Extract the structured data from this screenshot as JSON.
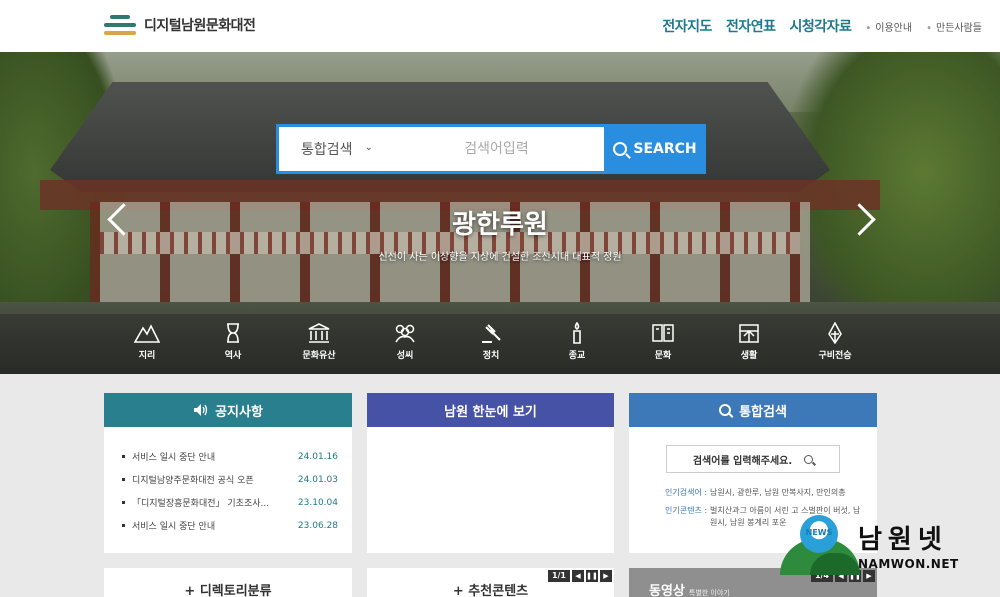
{
  "header": {
    "logo_text": "디지털남원문화대전",
    "main_links": [
      "전자지도",
      "전자연표",
      "시청각자료"
    ],
    "sub_links": [
      "이용안내",
      "만든사람들"
    ]
  },
  "search": {
    "category": "통합검색",
    "placeholder": "검색어입력",
    "button": "SEARCH"
  },
  "slide": {
    "title": "광한루원",
    "subtitle": "신선이 사는 이상향을 지상에 건설한 조선시대 대표적 정원"
  },
  "categories": [
    {
      "label": "지리",
      "icon": "mountain-icon"
    },
    {
      "label": "역사",
      "icon": "hourglass-icon"
    },
    {
      "label": "문화유산",
      "icon": "temple-icon"
    },
    {
      "label": "성씨",
      "icon": "people-icon"
    },
    {
      "label": "정치",
      "icon": "gavel-icon"
    },
    {
      "label": "종교",
      "icon": "candle-icon"
    },
    {
      "label": "문화",
      "icon": "book-icon"
    },
    {
      "label": "생활",
      "icon": "house-icon"
    },
    {
      "label": "구비전승",
      "icon": "pen-icon"
    }
  ],
  "notice": {
    "title": "공지사항",
    "items": [
      {
        "title": "서비스 일시 중단 안내",
        "date": "24.01.16"
      },
      {
        "title": "디지털남양주문화대전 공식 오픈",
        "date": "24.01.03"
      },
      {
        "title": "「디지털장흥문화대전」 기초조사...",
        "date": "23.10.04"
      },
      {
        "title": "서비스 일시 중단 안내",
        "date": "23.06.28"
      }
    ]
  },
  "glance": {
    "title": "남원 한눈에 보기"
  },
  "integrated": {
    "title": "통합검색",
    "input_label": "검색어를 입력해주세요.",
    "popular_keywords_label": "인기검색어 :",
    "popular_keywords": "남원시, 광한루, 남원 만복사지, 만인의총",
    "popular_contents_label": "인기콘텐츠 :",
    "popular_contents": "벌치산과그 아름이 서린 고 스벌판이 버섯, 남원시, 남원 봉계리 포운"
  },
  "bottom": {
    "directory": "+ 디렉토리분류",
    "recommend": "+ 추천콘텐츠",
    "recommend_pager": "1/1",
    "video": "동영상",
    "video_sub": "특별한 이야기",
    "video_pager": "1/4"
  },
  "watermark": {
    "ball_text": "NEWS",
    "name": "남원넷",
    "en": "NAMWON.NET"
  }
}
